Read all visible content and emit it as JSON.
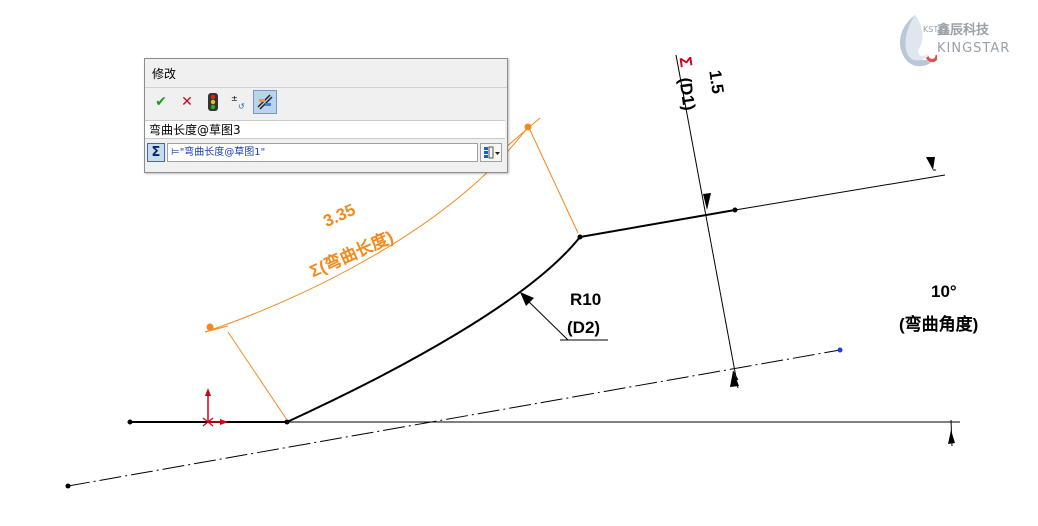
{
  "dialog": {
    "title": "修改",
    "toolbar": {
      "ok_icon": "checkmark-icon",
      "cancel_icon": "close-icon",
      "rebuild_icon": "traffic-light-icon",
      "spin_icon": "spin-increment-icon",
      "mark_icon": "mark-dimension-icon"
    },
    "name_value": "弯曲长度@草图3",
    "sigma_label": "Σ",
    "equation_value": "⊨\"弯曲长度@草图1\""
  },
  "dimensions": {
    "arc_value": "3.35",
    "arc_label": "Σ(弯曲长度)",
    "thickness_value": "1.5",
    "thickness_sigma": "Σ",
    "thickness_label": "(D1)",
    "radius_value": "R10",
    "radius_label": "(D2)",
    "angle_value": "10°",
    "angle_label": "(弯曲角度)"
  },
  "logo": {
    "kst": "KST",
    "cn": "鑫辰科技",
    "en": "KINGSTAR"
  },
  "colors": {
    "dimension_driven": "#f28a1e",
    "sketch_line": "#000000",
    "origin": "#d0021b",
    "point_blue": "#1f3fd6"
  }
}
